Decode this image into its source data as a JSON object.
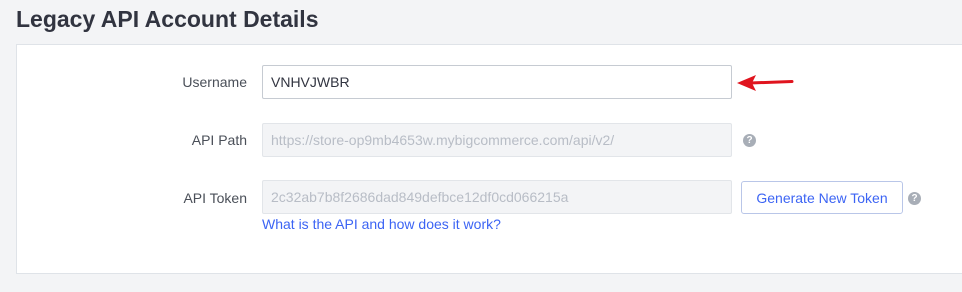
{
  "page": {
    "title": "Legacy API Account Details"
  },
  "form": {
    "username": {
      "label": "Username",
      "value": "VNHVJWBR"
    },
    "api_path": {
      "label": "API Path",
      "value": "https://store-op9mb4653w.mybigcommerce.com/api/v2/"
    },
    "api_token": {
      "label": "API Token",
      "value": "2c32ab7b8f2686dad849defbce12df0cd066215a"
    },
    "generate_button_label": "Generate New Token",
    "help_link_text": "What is the API and how does it work?",
    "help_icon_glyph": "?"
  },
  "colors": {
    "annotation_arrow": "#e0141e",
    "link": "#3c64f4"
  },
  "icons": {
    "help": "question-circle-icon",
    "annotation": "red-arrow-icon"
  }
}
